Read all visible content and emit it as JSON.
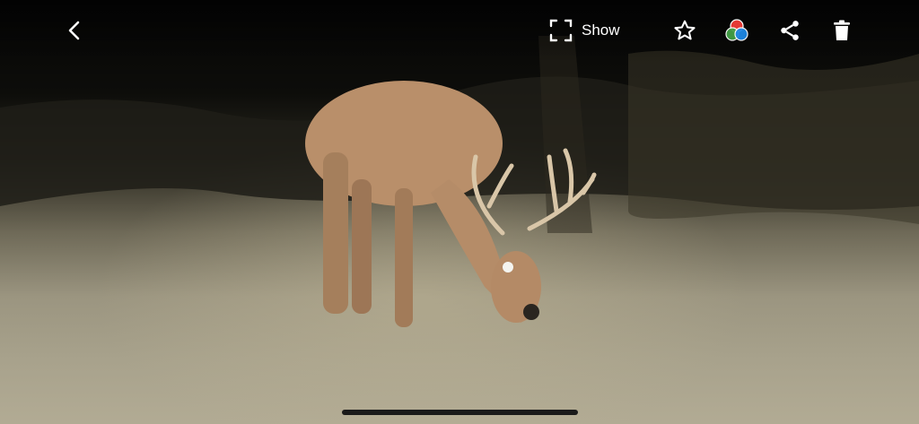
{
  "toolbar": {
    "show_label": "Show",
    "icons": {
      "back": "back-chevron-icon",
      "fullscreen": "fullscreen-corners-icon",
      "favorite": "star-icon",
      "color_filter": "color-circles-icon",
      "share": "share-icon",
      "delete": "trash-icon"
    }
  },
  "colors": {
    "icon": "#ffffff",
    "filter_red": "#e53935",
    "filter_green": "#43a047",
    "filter_blue": "#1e88e5",
    "home_indicator": "#1a1a1a"
  }
}
